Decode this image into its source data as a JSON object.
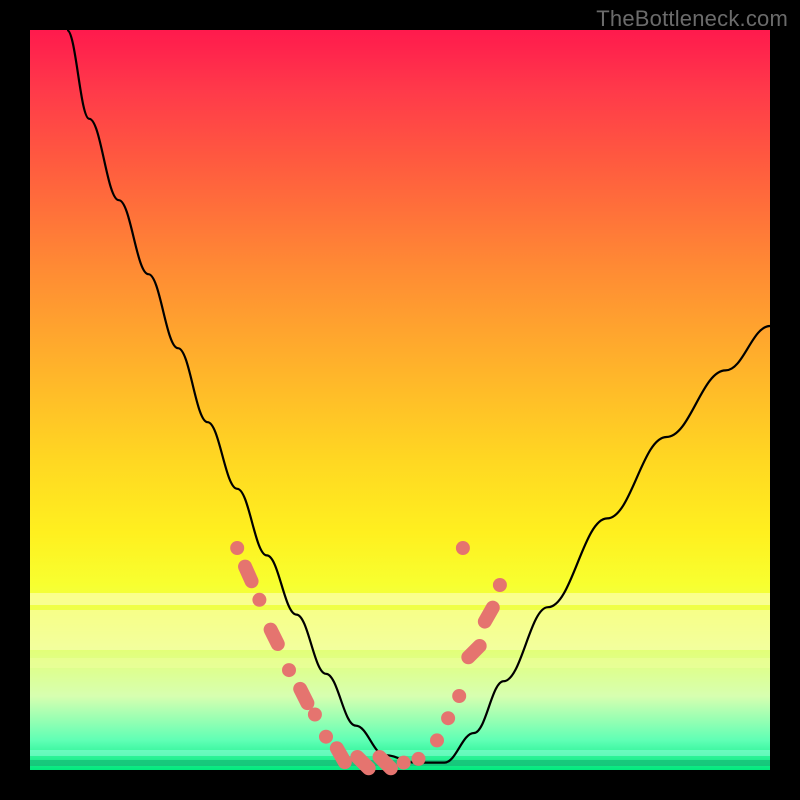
{
  "watermark": "TheBottleneck.com",
  "colors": {
    "frame": "#000000",
    "gradient_top": "#ff1a4d",
    "gradient_mid": "#ffd722",
    "gradient_bottom": "#03e87e",
    "curve": "#000000",
    "marker": "#e5746f"
  },
  "chart_data": {
    "type": "line",
    "title": "",
    "xlabel": "",
    "ylabel": "",
    "xlim": [
      0,
      100
    ],
    "ylim": [
      0,
      100
    ],
    "grid": false,
    "legend": false,
    "description": "V-shaped bottleneck curve on rainbow heatmap background; single black curve descending from top-left to a flat trough near x≈45 then rising toward upper-right. Salmon-colored dot/pill markers clustered along both flanks near the trough.",
    "series": [
      {
        "name": "bottleneck-curve",
        "x": [
          5,
          8,
          12,
          16,
          20,
          24,
          28,
          32,
          36,
          40,
          44,
          48,
          52,
          56,
          60,
          64,
          70,
          78,
          86,
          94,
          100
        ],
        "y": [
          100,
          88,
          77,
          67,
          57,
          47,
          38,
          29,
          21,
          13,
          6,
          2,
          1,
          1,
          5,
          12,
          22,
          34,
          45,
          54,
          60
        ]
      }
    ],
    "markers": [
      {
        "shape": "dot",
        "x": 28.0,
        "y": 30.0
      },
      {
        "shape": "pill",
        "x": 29.5,
        "y": 26.5
      },
      {
        "shape": "dot",
        "x": 31.0,
        "y": 23.0
      },
      {
        "shape": "pill",
        "x": 33.0,
        "y": 18.0
      },
      {
        "shape": "dot",
        "x": 35.0,
        "y": 13.5
      },
      {
        "shape": "pill",
        "x": 37.0,
        "y": 10.0
      },
      {
        "shape": "dot",
        "x": 38.5,
        "y": 7.5
      },
      {
        "shape": "dot",
        "x": 40.0,
        "y": 4.5
      },
      {
        "shape": "pill",
        "x": 42.0,
        "y": 2.0
      },
      {
        "shape": "pill",
        "x": 45.0,
        "y": 1.0
      },
      {
        "shape": "pill",
        "x": 48.0,
        "y": 1.0
      },
      {
        "shape": "dot",
        "x": 50.5,
        "y": 1.0
      },
      {
        "shape": "dot",
        "x": 52.5,
        "y": 1.5
      },
      {
        "shape": "dot",
        "x": 55.0,
        "y": 4.0
      },
      {
        "shape": "dot",
        "x": 56.5,
        "y": 7.0
      },
      {
        "shape": "dot",
        "x": 58.0,
        "y": 10.0
      },
      {
        "shape": "pill",
        "x": 60.0,
        "y": 16.0
      },
      {
        "shape": "pill",
        "x": 62.0,
        "y": 21.0
      },
      {
        "shape": "dot",
        "x": 63.5,
        "y": 25.0
      },
      {
        "shape": "dot",
        "x": 58.5,
        "y": 30.0
      }
    ]
  }
}
